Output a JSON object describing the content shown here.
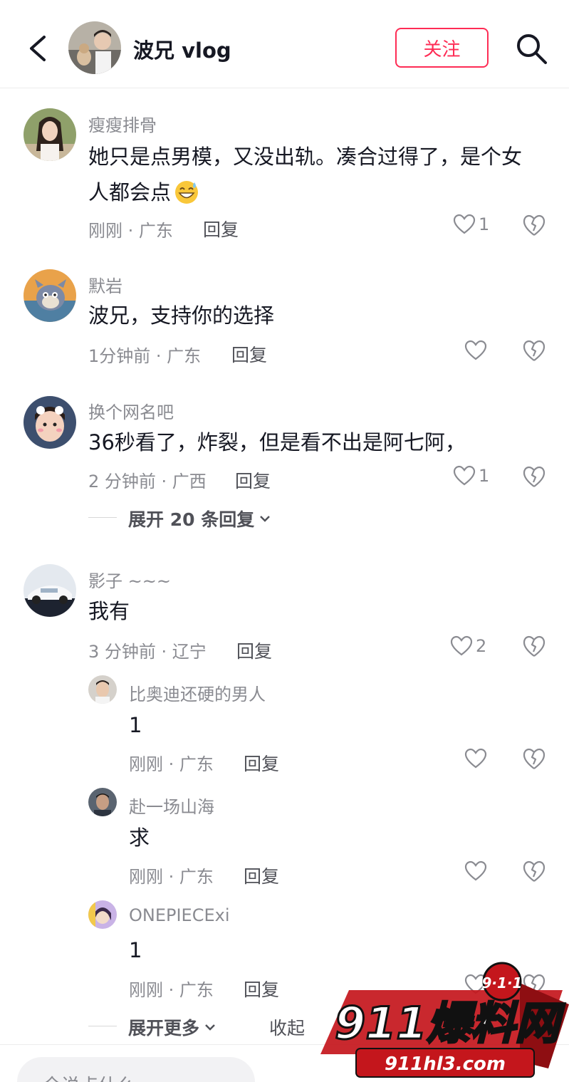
{
  "header": {
    "name": "波兄 vlog",
    "follow_label": "关注"
  },
  "comments": [
    {
      "user": "瘦瘦排骨",
      "text_line1": "她只是点男模，又没出轨。凑合过得了，是个女",
      "text_line2": "人都会点",
      "meta": "刚刚 · 广东",
      "reply": "回复",
      "likes": "1"
    },
    {
      "user": "默岩",
      "text": "波兄，支持你的选择",
      "meta": "1分钟前 · 广东",
      "reply": "回复"
    },
    {
      "user": "换个网名吧",
      "text": "36秒看了，炸裂，但是看不出是阿七阿，",
      "meta": "2 分钟前 · 广西",
      "reply": "回复",
      "likes": "1",
      "expand": "展开 20 条回复"
    },
    {
      "user": "影子 ~~~",
      "text": "我有",
      "meta": "3 分钟前 · 辽宁",
      "reply": "回复",
      "likes": "2",
      "replies": [
        {
          "user": "比奥迪还硬的男人",
          "text": "1",
          "meta": "刚刚 · 广东",
          "reply": "回复"
        },
        {
          "user": "赴一场山海",
          "text": "求",
          "meta": "刚刚 · 广东",
          "reply": "回复"
        },
        {
          "user": "ONEPIECExi",
          "text": "1",
          "meta": "刚刚 · 广东",
          "reply": "回复"
        }
      ],
      "expand_more": "展开更多",
      "collapse": "收起"
    }
  ],
  "input": {
    "placeholder": "全说点什么"
  },
  "watermark": {
    "text": "911爆料网",
    "badge": "9·1·1",
    "url": "911hl3.com"
  },
  "colors": {
    "accent": "#fe2c55",
    "muted": "#8a8b91",
    "text": "#161823"
  }
}
